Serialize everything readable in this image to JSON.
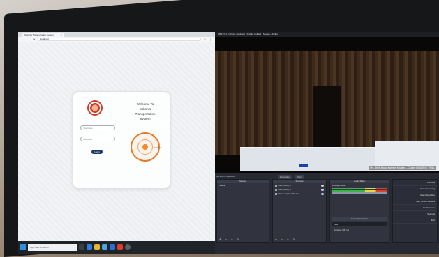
{
  "browser": {
    "tab_title": "Sabonis Transportation System",
    "url": "localhost"
  },
  "login": {
    "username_placeholder": "Username",
    "password_placeholder": "Password",
    "login_button": "Login",
    "welcome_line1": "Welcome To",
    "welcome_line2": "Sabonis",
    "welcome_line3": "Transportation",
    "welcome_line4": "System",
    "dial_label": "Sabonis"
  },
  "taskbar": {
    "search_placeholder": "Type here to search"
  },
  "obs": {
    "window_title": "OBS 27.1.3 (64-bit, windows) - Profile: Untitled - Scenes: Untitled",
    "caption": "Pre-Brief: Abdul Kareem Khaleel – Cluster ROUTINE TRIAL",
    "status_note": "No source selected",
    "tab_properties": "Properties",
    "tab_filters": "Filters",
    "scenes_header": "Scenes",
    "scene_item": "Scene",
    "sources_header": "Sources",
    "sources": [
      "Text (GDI+) 2",
      "Text (GDI+) 2",
      "Video Capture Device"
    ],
    "mixer_header": "Audio Mixer",
    "mixer_item": "Desktop Audio",
    "transitions_header": "Scene Transitions",
    "transition_value": "Fade",
    "duration_label": "Duration",
    "duration_value": "300 ms",
    "controls": [
      "Controls",
      "Start Streaming",
      "Start Recording",
      "Start Virtual Camera",
      "Studio Mode",
      "Settings",
      "Exit"
    ],
    "dock_footer": "+ − ∧ ∨"
  }
}
